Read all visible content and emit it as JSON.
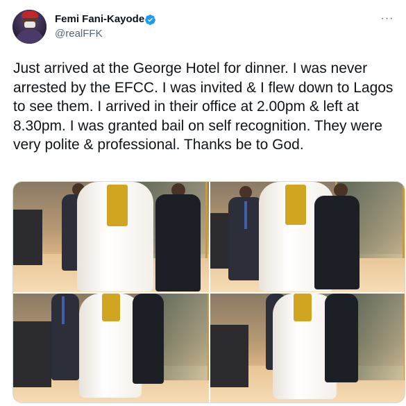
{
  "tweet": {
    "display_name": "Femi Fani-Kayode",
    "handle": "@realFFK",
    "verified": true,
    "more_icon": "ellipsis-icon",
    "text": "Just arrived at the George Hotel for dinner. I was never arrested by the EFCC. I was invited & I flew down to Lagos to see them. I arrived in their office at 2.00pm & left at 8.30pm. I was granted bail on self recognition. They were very polite & professional. Thanks be to God."
  },
  "media": {
    "photo_count": 4
  },
  "colors": {
    "verified_blue": "#1d9bf0",
    "text_primary": "#0f1419",
    "text_secondary": "#536471",
    "border": "#cfd9de"
  }
}
